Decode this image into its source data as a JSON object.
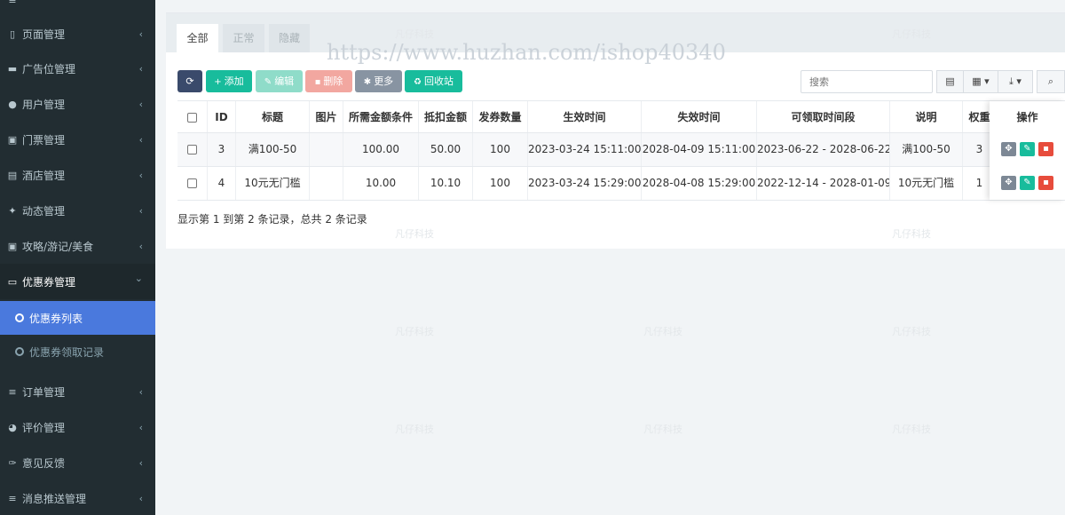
{
  "sidebar": {
    "items": [
      {
        "label": "页面管理",
        "icon": "bookmark-icon",
        "glyph": "▯"
      },
      {
        "label": "广告位管理",
        "icon": "card-icon",
        "glyph": "▬"
      },
      {
        "label": "用户管理",
        "icon": "user-icon",
        "glyph": "●"
      },
      {
        "label": "门票管理",
        "icon": "ticket-icon",
        "glyph": "▣"
      },
      {
        "label": "酒店管理",
        "icon": "building-icon",
        "glyph": "▤"
      },
      {
        "label": "动态管理",
        "icon": "walker-icon",
        "glyph": "✦"
      },
      {
        "label": "攻略/游记/美食",
        "icon": "image-icon",
        "glyph": "▣"
      },
      {
        "label": "优惠券管理",
        "icon": "visa-card-icon",
        "glyph": "▭"
      }
    ],
    "subitems": [
      {
        "label": "优惠券列表"
      },
      {
        "label": "优惠券领取记录"
      }
    ],
    "items_after": [
      {
        "label": "订单管理",
        "icon": "list-icon",
        "glyph": "≡"
      },
      {
        "label": "评价管理",
        "icon": "github-icon",
        "glyph": "◕"
      },
      {
        "label": "意见反馈",
        "icon": "feather-icon",
        "glyph": "✑"
      },
      {
        "label": "消息推送管理",
        "icon": "list-icon",
        "glyph": "≡"
      }
    ],
    "chevron_left": "‹",
    "chevron_down": "⌄"
  },
  "tabs": [
    "全部",
    "正常",
    "隐藏"
  ],
  "watermark": "https://www.huzhan.com/ishop40340",
  "faint_mark": "凡仔科技",
  "toolbar": {
    "refresh_icon": "⟳",
    "add": {
      "icon": "+",
      "label": "添加"
    },
    "edit": {
      "icon": "✎",
      "label": "编辑"
    },
    "delete": {
      "icon": "▪",
      "label": "删除"
    },
    "more": {
      "icon": "✱",
      "label": "更多"
    },
    "recycle": {
      "icon": "♻",
      "label": "回收站"
    },
    "search_placeholder": "搜索",
    "view_icon": "▤",
    "columns_icon": "▦ ▾",
    "export_icon": "⤓ ▾",
    "search_icon": "⌕"
  },
  "table": {
    "headers": [
      "ID",
      "标题",
      "图片",
      "所需金额条件",
      "抵扣金额",
      "发券数量",
      "生效时间",
      "失效时间",
      "可领取时间段",
      "说明",
      "权重"
    ],
    "op_header": "操作",
    "rows": [
      [
        "3",
        "满100-50",
        "",
        "100.00",
        "50.00",
        "100",
        "2023-03-24 15:11:00",
        "2028-04-09 15:11:00",
        "2023-06-22 - 2028-06-22",
        "满100-50",
        "3"
      ],
      [
        "4",
        "10元无门槛",
        "",
        "10.00",
        "10.10",
        "100",
        "2023-03-24 15:29:00",
        "2028-04-08 15:29:00",
        "2022-12-14 - 2028-01-09",
        "10元无门槛",
        "1"
      ]
    ],
    "op_icons": {
      "drag": "✥",
      "edit": "✎",
      "delete": "▪"
    }
  },
  "footer": "显示第 1 到第 2 条记录，总共 2 条记录",
  "colors": {
    "sidebar_bg": "#222d32",
    "active": "#4a79dd",
    "green": "#18bc9c",
    "red": "#e74c3c",
    "dark": "#3a4a6b"
  }
}
